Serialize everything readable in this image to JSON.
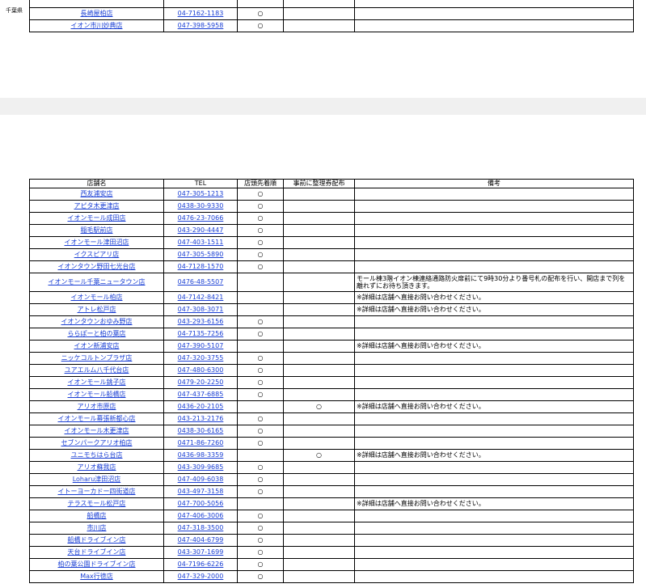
{
  "prefecture_label": "千葉県",
  "top_rows": [
    {
      "name": "長崎屋柏店",
      "tel": "04-7162-1183",
      "lineup": "○",
      "ticket": "",
      "remarks": ""
    },
    {
      "name": "イオン市川妙典店",
      "tel": "047-398-5958",
      "lineup": "○",
      "ticket": "",
      "remarks": ""
    }
  ],
  "headers": {
    "name": "店舗名",
    "tel": "TEL",
    "lineup": "店頭先着順",
    "ticket": "事前に整理券配布",
    "remarks": "備考"
  },
  "rows": [
    {
      "name": "西友浦安店",
      "tel": "047-305-1213",
      "lineup": "○",
      "ticket": "",
      "remarks": ""
    },
    {
      "name": "アピタ木更津店",
      "tel": "0438-30-9330",
      "lineup": "○",
      "ticket": "",
      "remarks": ""
    },
    {
      "name": "イオンモール成田店",
      "tel": "0476-23-7066",
      "lineup": "○",
      "ticket": "",
      "remarks": ""
    },
    {
      "name": "稲毛駅前店",
      "tel": "043-290-4447",
      "lineup": "○",
      "ticket": "",
      "remarks": ""
    },
    {
      "name": "イオンモール津田沼店",
      "tel": "047-403-1511",
      "lineup": "○",
      "ticket": "",
      "remarks": ""
    },
    {
      "name": "イクスピアリ店",
      "tel": "047-305-5890",
      "lineup": "○",
      "ticket": "",
      "remarks": ""
    },
    {
      "name": "イオンタウン野田七光台店",
      "tel": "04-7128-1570",
      "lineup": "○",
      "ticket": "",
      "remarks": ""
    },
    {
      "name": "イオンモール千葉ニュータウン店",
      "tel": "0476-48-5507",
      "lineup": "",
      "ticket": "",
      "remarks": "モール棟3階イオン棟連絡通路防火扉前にて9時30分より番号札の配布を行い、開店まで列を離れずにお待ち頂きます。",
      "tall": true
    },
    {
      "name": "イオンモール柏店",
      "tel": "04-7142-8421",
      "lineup": "",
      "ticket": "",
      "remarks": "※詳細は店舗へ直接お問い合わせください。"
    },
    {
      "name": "アトレ松戸店",
      "tel": "047-308-3071",
      "lineup": "",
      "ticket": "",
      "remarks": "※詳細は店舗へ直接お問い合わせください。"
    },
    {
      "name": "イオンタウンおゆみ野店",
      "tel": "043-293-6156",
      "lineup": "○",
      "ticket": "",
      "remarks": ""
    },
    {
      "name": "ららぽーと柏の葉店",
      "tel": "04-7135-7256",
      "lineup": "○",
      "ticket": "",
      "remarks": ""
    },
    {
      "name": "イオン新浦安店",
      "tel": "047-390-5107",
      "lineup": "",
      "ticket": "",
      "remarks": "※詳細は店舗へ直接お問い合わせください。"
    },
    {
      "name": "ニッケコルトンプラザ店",
      "tel": "047-320-3755",
      "lineup": "○",
      "ticket": "",
      "remarks": ""
    },
    {
      "name": "ユアエルム八千代台店",
      "tel": "047-480-6300",
      "lineup": "○",
      "ticket": "",
      "remarks": ""
    },
    {
      "name": "イオンモール銚子店",
      "tel": "0479-20-2250",
      "lineup": "○",
      "ticket": "",
      "remarks": ""
    },
    {
      "name": "イオンモール船橋店",
      "tel": "047-437-6885",
      "lineup": "○",
      "ticket": "",
      "remarks": ""
    },
    {
      "name": "アリオ市原店",
      "tel": "0436-20-2105",
      "lineup": "",
      "ticket": "○",
      "remarks": "※詳細は店舗へ直接お問い合わせください。"
    },
    {
      "name": "イオンモール幕張新都心店",
      "tel": "043-213-2176",
      "lineup": "○",
      "ticket": "",
      "remarks": ""
    },
    {
      "name": "イオンモール木更津店",
      "tel": "0438-30-6165",
      "lineup": "○",
      "ticket": "",
      "remarks": ""
    },
    {
      "name": "セブンパークアリオ柏店",
      "tel": "0471-86-7260",
      "lineup": "○",
      "ticket": "",
      "remarks": ""
    },
    {
      "name": "ユニモちはら台店",
      "tel": "0436-98-3359",
      "lineup": "",
      "ticket": "○",
      "remarks": "※詳細は店舗へ直接お問い合わせください。"
    },
    {
      "name": "アリオ蘇我店",
      "tel": "043-309-9685",
      "lineup": "○",
      "ticket": "",
      "remarks": ""
    },
    {
      "name": "Loharu津田沼店",
      "tel": "047-409-6038",
      "lineup": "○",
      "ticket": "",
      "remarks": ""
    },
    {
      "name": "イトーヨーカドー四街道店",
      "tel": "043-497-3158",
      "lineup": "○",
      "ticket": "",
      "remarks": ""
    },
    {
      "name": "テラスモール松戸店",
      "tel": "047-700-5056",
      "lineup": "",
      "ticket": "",
      "remarks": "※詳細は店舗へ直接お問い合わせください。"
    },
    {
      "name": "船橋店",
      "tel": "047-406-3006",
      "lineup": "○",
      "ticket": "",
      "remarks": ""
    },
    {
      "name": "市川店",
      "tel": "047-318-3500",
      "lineup": "○",
      "ticket": "",
      "remarks": ""
    },
    {
      "name": "船橋ドライブイン店",
      "tel": "047-404-6799",
      "lineup": "○",
      "ticket": "",
      "remarks": ""
    },
    {
      "name": "天台ドライブイン店",
      "tel": "043-307-1699",
      "lineup": "○",
      "ticket": "",
      "remarks": ""
    },
    {
      "name": "柏の葉公園ドライブイン店",
      "tel": "04-7196-6226",
      "lineup": "○",
      "ticket": "",
      "remarks": ""
    },
    {
      "name": "Max行徳店",
      "tel": "047-329-2000",
      "lineup": "○",
      "ticket": "",
      "remarks": ""
    }
  ]
}
